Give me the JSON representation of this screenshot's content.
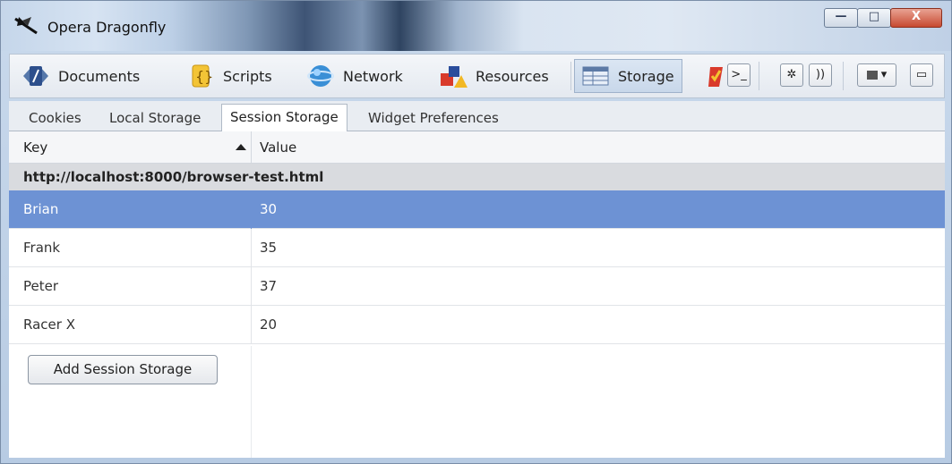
{
  "window": {
    "title": "Opera Dragonfly",
    "controls": {
      "minimize": "—",
      "maximize": "□",
      "close": "X"
    }
  },
  "toolbar": {
    "items": [
      {
        "label": "Documents",
        "icon": "documents-icon"
      },
      {
        "label": "Scripts",
        "icon": "scripts-icon"
      },
      {
        "label": "Network",
        "icon": "network-icon"
      },
      {
        "label": "Resources",
        "icon": "resources-icon"
      },
      {
        "label": "Storage",
        "icon": "storage-icon",
        "active": true
      }
    ],
    "extra_icons": [
      "errors-icon",
      "console-icon",
      "settings-icon",
      "remote-debug-icon",
      "window-layout-icon",
      "dock-icon"
    ],
    "console_glyph": ">_",
    "settings_glyph": "✲",
    "remote_glyph": "))",
    "layout_glyph": "▾",
    "dock_glyph": "▭"
  },
  "tabs": [
    {
      "label": "Cookies"
    },
    {
      "label": "Local Storage"
    },
    {
      "label": "Session Storage",
      "active": true
    },
    {
      "label": "Widget Preferences"
    }
  ],
  "table": {
    "columns": {
      "key": "Key",
      "value": "Value"
    },
    "sort": "ascending",
    "group": "http://localhost:8000/browser-test.html",
    "rows": [
      {
        "key": "Brian",
        "value": "30",
        "selected": true
      },
      {
        "key": "Frank",
        "value": "35"
      },
      {
        "key": "Peter",
        "value": "37"
      },
      {
        "key": "Racer X",
        "value": "20"
      }
    ]
  },
  "add_button": "Add Session Storage",
  "colors": {
    "selected_row": "#6d92d4",
    "close_button": "#c74a31"
  }
}
